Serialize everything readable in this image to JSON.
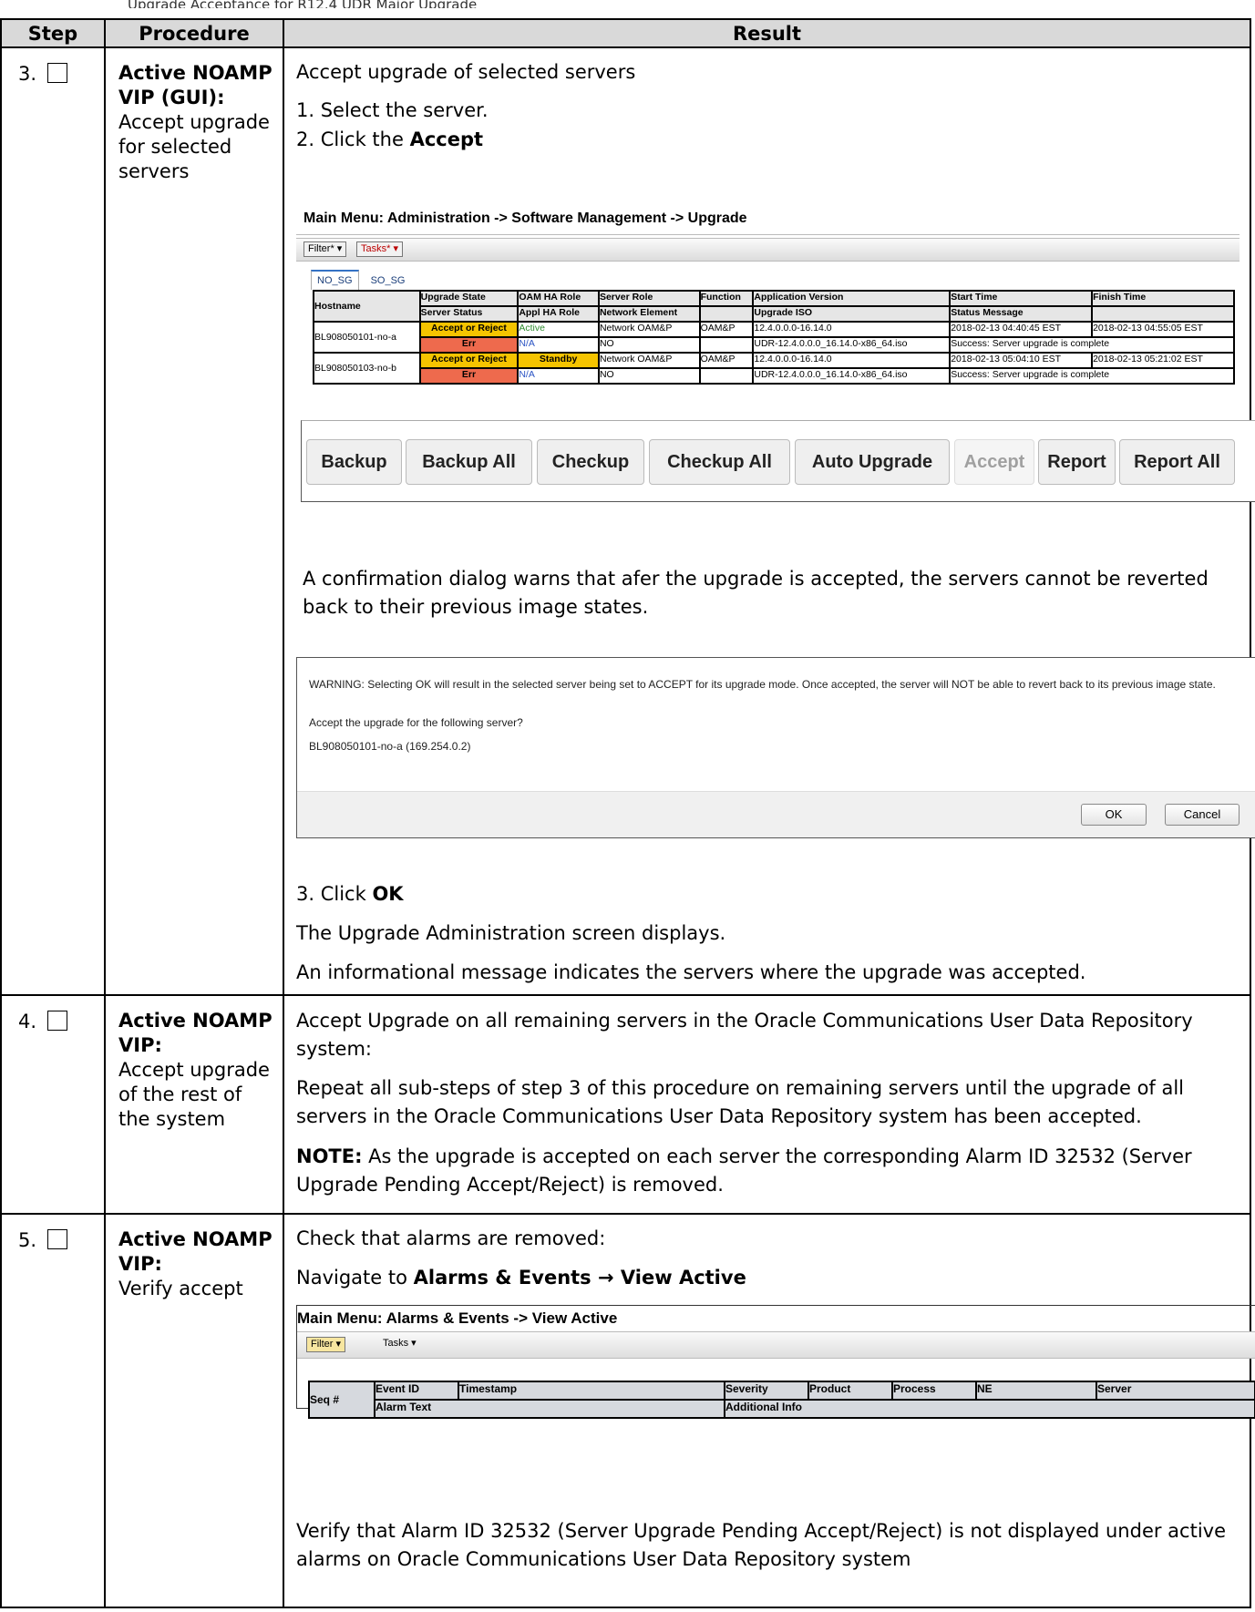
{
  "top_fragment": "Upgrade Acceptance for R12.4 UDR Major Upgrade",
  "headers": {
    "step": "Step",
    "procedure": "Procedure",
    "result": "Result"
  },
  "step3": {
    "number": "3.",
    "title": "Active NOAMP VIP (GUI):",
    "desc": "Accept upgrade for selected servers",
    "intro": "Accept upgrade of selected servers",
    "sub1": "1. Select the server.",
    "sub2_prefix": "2. Click the ",
    "sub2_bold": "Accept",
    "screenshot": {
      "menu_title": "Main Menu: Administration -> Software Management -> Upgrade",
      "filter_btn": "Filter* ▾",
      "tasks_btn": "Tasks* ▾",
      "tabs": [
        "NO_SG",
        "SO_SG"
      ],
      "header_row1": [
        "Hostname",
        "Upgrade State",
        "OAM HA Role",
        "Server Role",
        "Function",
        "Application Version",
        "Start Time",
        "Finish Time"
      ],
      "header_row2": [
        "Server Status",
        "Appl HA Role",
        "Network Element",
        "",
        "Upgrade ISO",
        "Status Message",
        ""
      ],
      "rows": [
        {
          "hostname": "BL908050101-no-a",
          "upgrade_state": "Accept or Reject",
          "oam_ha_role": "Active",
          "server_role": "Network OAM&P",
          "function": "OAM&P",
          "app_version": "12.4.0.0.0-16.14.0",
          "start_time": "2018-02-13 04:40:45 EST",
          "finish_time": "2018-02-13 04:55:05 EST",
          "server_status": "Err",
          "appl_ha_role": "N/A",
          "network_element": "NO",
          "upgrade_iso": "UDR-12.4.0.0.0_16.14.0-x86_64.iso",
          "status_message": "Success: Server upgrade is complete"
        },
        {
          "hostname": "BL908050103-no-b",
          "upgrade_state": "Accept or Reject",
          "oam_ha_role": "Standby",
          "server_role": "Network OAM&P",
          "function": "OAM&P",
          "app_version": "12.4.0.0.0-16.14.0",
          "start_time": "2018-02-13 05:04:10 EST",
          "finish_time": "2018-02-13 05:21:02 EST",
          "server_status": "Err",
          "appl_ha_role": "N/A",
          "network_element": "NO",
          "upgrade_iso": "UDR-12.4.0.0.0_16.14.0-x86_64.iso",
          "status_message": "Success: Server upgrade is complete"
        }
      ],
      "buttons": [
        "Backup",
        "Backup All",
        "Checkup",
        "Checkup All",
        "Auto Upgrade",
        "Accept",
        "Report",
        "Report All"
      ]
    },
    "confirm_text": "A confirmation dialog warns that afer the upgrade is accepted, the servers cannot be reverted back to their previous image states.",
    "dialog": {
      "warning": "WARNING: Selecting OK will result in the selected server being set to ACCEPT for its upgrade mode. Once accepted, the server will NOT be able to revert back to its previous image state.",
      "question": "Accept the upgrade for the following server?",
      "server": "BL908050101-no-a (169.254.0.2)",
      "ok": "OK",
      "cancel": "Cancel"
    },
    "sub3_prefix": "3. Click ",
    "sub3_bold": "OK",
    "after1": "The Upgrade Administration screen displays.",
    "after2": "An informational message indicates the servers where the upgrade was accepted."
  },
  "step4": {
    "number": "4.",
    "title": "Active NOAMP VIP:",
    "desc": "Accept upgrade of the rest of the system",
    "p1": "Accept Upgrade on all remaining servers in the Oracle Communications User Data Repository system:",
    "p2": "Repeat all sub-steps of step 3 of this procedure on remaining servers until the upgrade of all servers in the Oracle Communications User Data Repository system has been accepted.",
    "note_bold": "NOTE:",
    "note": " As the upgrade is accepted on each server the corresponding Alarm ID 32532 (Server Upgrade Pending Accept/Reject) is removed."
  },
  "step5": {
    "number": "5.",
    "title": "Active NOAMP VIP:",
    "desc": "Verify accept",
    "p1": "Check that alarms are removed:",
    "nav_prefix": "Navigate to ",
    "nav_bold": "Alarms & Events → View Active",
    "screenshot": {
      "menu_title": "Main Menu: Alarms & Events -> View Active",
      "filter_btn": "Filter ▾",
      "tasks_btn": "Tasks ▾",
      "header_row1": [
        "Seq #",
        "Event ID",
        "Timestamp",
        "Severity",
        "Product",
        "Process",
        "NE",
        "Server"
      ],
      "header_row2": [
        "Alarm Text",
        "Additional Info"
      ]
    },
    "p2": "Verify that Alarm ID 32532 (Server Upgrade Pending Accept/Reject) is not displayed under active alarms on Oracle Communications User Data Repository system"
  }
}
